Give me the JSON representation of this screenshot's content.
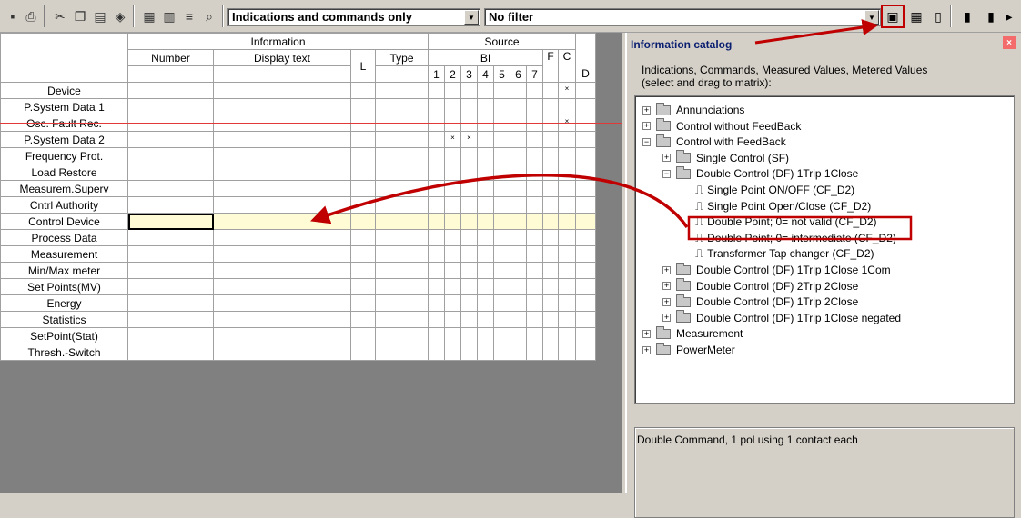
{
  "toolbar": {
    "category_filter": "Indications and commands only",
    "secondary_filter": "No filter",
    "icons": [
      "save-icon",
      "print-icon",
      "cut-icon",
      "copy-icon",
      "paste-icon",
      "insert-icon",
      "compile-icon",
      "filter-icon",
      "sort-icon",
      "find-icon",
      "catalog-icon",
      "grid-icon",
      "info-icon",
      "matrix-icon",
      "matrix2-icon"
    ]
  },
  "matrix": {
    "headers": {
      "information": "Information",
      "source": "Source",
      "number": "Number",
      "display_text": "Display text",
      "l": "L",
      "type": "Type",
      "bi": "BI",
      "f": "F",
      "c": "C",
      "d": "D",
      "bi_cols": [
        "1",
        "2",
        "3",
        "4",
        "5",
        "6",
        "7"
      ]
    },
    "rows": [
      {
        "label": "Device",
        "marks": [
          "c"
        ]
      },
      {
        "label": "P.System Data 1",
        "marks": []
      },
      {
        "label": "Osc. Fault Rec.",
        "marks": [
          "c"
        ]
      },
      {
        "label": "P.System Data 2",
        "marks": [
          "2",
          "3"
        ]
      },
      {
        "label": "Frequency Prot.",
        "marks": []
      },
      {
        "label": "Load Restore",
        "marks": []
      },
      {
        "label": "Measurem.Superv",
        "marks": []
      },
      {
        "label": "Cntrl Authority",
        "marks": []
      },
      {
        "label": "Control Device",
        "marks": []
      },
      {
        "label": "Process Data",
        "marks": []
      },
      {
        "label": "Measurement",
        "marks": []
      },
      {
        "label": "Min/Max meter",
        "marks": []
      },
      {
        "label": "Set Points(MV)",
        "marks": []
      },
      {
        "label": "Energy",
        "marks": []
      },
      {
        "label": "Statistics",
        "marks": []
      },
      {
        "label": "SetPoint(Stat)",
        "marks": []
      },
      {
        "label": "Thresh.-Switch",
        "marks": []
      }
    ],
    "mark_symbol": "×",
    "selected_row": "Control Device"
  },
  "catalog": {
    "title": "Information catalog",
    "close": "×",
    "description_line1": "Indications, Commands, Measured Values, Metered Values",
    "description_line2": "(select and drag to matrix):",
    "tree": [
      {
        "label": "Annunciations",
        "type": "folder",
        "expander": "+"
      },
      {
        "label": "Control without FeedBack",
        "type": "folder",
        "expander": "+"
      },
      {
        "label": "Control with FeedBack",
        "type": "folder",
        "expander": "−"
      },
      {
        "label": "Single Control (SF)",
        "type": "folder",
        "expander": "+"
      },
      {
        "label": "Double Control (DF) 1Trip 1Close",
        "type": "folder",
        "expander": "−"
      },
      {
        "label": "Single Point ON/OFF (CF_D2)",
        "type": "leaf"
      },
      {
        "label": "Single Point Open/Close (CF_D2)",
        "type": "leaf"
      },
      {
        "label": "Double Point; 0= not valid (CF_D2)",
        "type": "leaf"
      },
      {
        "label": "Double Point; 0= intermediate (CF_D2)",
        "type": "leaf"
      },
      {
        "label": "Transformer Tap changer (CF_D2)",
        "type": "leaf"
      },
      {
        "label": "Double Control (DF) 1Trip 1Close 1Com",
        "type": "folder",
        "expander": "+"
      },
      {
        "label": "Double Control (DF) 2Trip 2Close",
        "type": "folder",
        "expander": "+"
      },
      {
        "label": "Double Control (DF) 1Trip 2Close",
        "type": "folder",
        "expander": "+"
      },
      {
        "label": "Double Control (DF) 1Trip 1Close negated",
        "type": "folder",
        "expander": "+"
      },
      {
        "label": "Measurement",
        "type": "folder",
        "expander": "+"
      },
      {
        "label": "PowerMeter",
        "type": "folder",
        "expander": "+"
      }
    ],
    "status_text": "Double Command, 1 pol  using 1 contact each"
  },
  "colors": {
    "annotation_red": "#c00000",
    "selected_row_fill": "#fffbd5",
    "row_label_border": "#3050d0"
  }
}
